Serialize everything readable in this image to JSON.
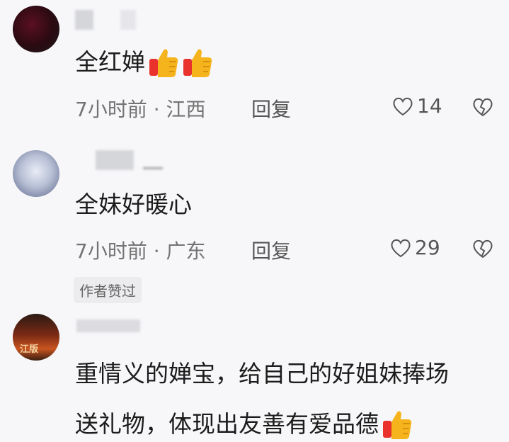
{
  "comments": [
    {
      "text": "全红婵",
      "thumbs": 2,
      "time": "7小时前",
      "location": "江西",
      "reply_label": "回复",
      "likes": "14"
    },
    {
      "text": "全妹好暖心",
      "thumbs": 0,
      "time": "7小时前",
      "location": "广东",
      "reply_label": "回复",
      "likes": "29",
      "badge": "作者赞过"
    },
    {
      "avatar_text": "江版",
      "line1": "重情义的婵宝，给自己的好姐妹捧场",
      "line2": "送礼物，体现出友善有爱品德",
      "thumbs": 1
    }
  ],
  "separator": "·",
  "colors": {
    "background": "#f7f7f9",
    "text": "#1c1c1c",
    "meta": "#737373",
    "thumb_red": "#e8322b",
    "thumb_yellow": "#f5b41c"
  }
}
